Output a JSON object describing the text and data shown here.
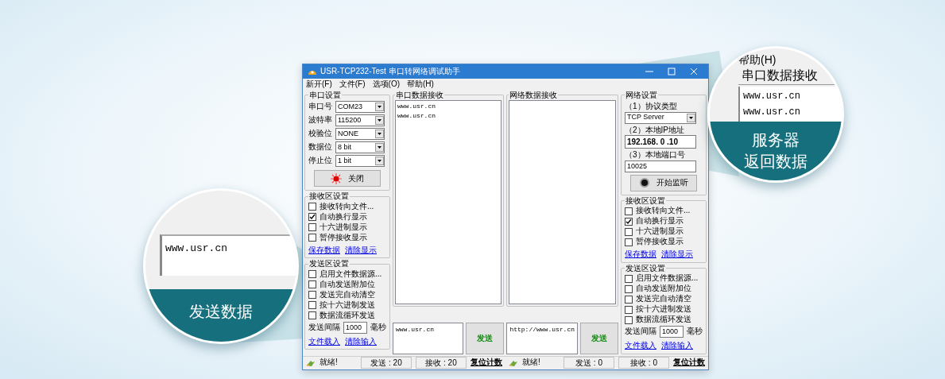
{
  "window": {
    "title": "USR-TCP232-Test 串口转网络调试助手",
    "menu": [
      "新开(F)",
      "文件(F)",
      "选项(O)",
      "帮助(H)"
    ]
  },
  "serial_settings": {
    "title": "串口设置",
    "fields": [
      {
        "label": "串口号",
        "value": "COM23"
      },
      {
        "label": "波特率",
        "value": "115200"
      },
      {
        "label": "校验位",
        "value": "NONE"
      },
      {
        "label": "数据位",
        "value": "8 bit"
      },
      {
        "label": "停止位",
        "value": "1 bit"
      }
    ],
    "button": {
      "label": "关闭",
      "active": true
    }
  },
  "serial_receive_settings": {
    "title": "接收区设置",
    "options": [
      {
        "label": "接收转向文件...",
        "checked": false
      },
      {
        "label": "自动换行显示",
        "checked": true
      },
      {
        "label": "十六进制显示",
        "checked": false
      },
      {
        "label": "暂停接收显示",
        "checked": false
      }
    ],
    "links": [
      "保存数据",
      "清除显示"
    ]
  },
  "serial_send_settings": {
    "title": "发送区设置",
    "options": [
      {
        "label": "启用文件数据源...",
        "checked": false
      },
      {
        "label": "自动发送附加位",
        "checked": false
      },
      {
        "label": "发送完自动清空",
        "checked": false
      },
      {
        "label": "按十六进制发送",
        "checked": false
      },
      {
        "label": "数据流循环发送",
        "checked": false
      }
    ],
    "interval": {
      "label": "发送间隔",
      "value": "1000",
      "unit": "毫秒"
    },
    "links": [
      "文件载入",
      "清除输入"
    ]
  },
  "serial_receive": {
    "title": "串口数据接收",
    "lines": [
      "www.usr.cn",
      "www.usr.cn"
    ]
  },
  "serial_send": {
    "value": "www.usr.cn",
    "button": "发送"
  },
  "network_receive": {
    "title": "网络数据接收"
  },
  "network_send": {
    "value": "http://www.usr.cn",
    "button": "发送"
  },
  "network_settings": {
    "title": "网络设置",
    "fields": [
      {
        "kind": "select",
        "label": "（1）协议类型",
        "value": "TCP Server"
      },
      {
        "kind": "ip",
        "label": "（2）本地IP地址",
        "value": "192.168. 0 .10"
      },
      {
        "kind": "input",
        "label": "（3）本地端口号",
        "value": "10025"
      }
    ],
    "button": {
      "label": "开始监听",
      "active": false
    }
  },
  "network_receive_settings": {
    "title": "接收区设置",
    "options": [
      {
        "label": "接收转向文件...",
        "checked": false
      },
      {
        "label": "自动换行显示",
        "checked": true
      },
      {
        "label": "十六进制显示",
        "checked": false
      },
      {
        "label": "暂停接收显示",
        "checked": false
      }
    ],
    "links": [
      "保存数据",
      "清除显示"
    ]
  },
  "network_send_settings": {
    "title": "发送区设置",
    "options": [
      {
        "label": "启用文件数据源...",
        "checked": false
      },
      {
        "label": "自动发送附加位",
        "checked": false
      },
      {
        "label": "发送完自动清空",
        "checked": false
      },
      {
        "label": "按十六进制发送",
        "checked": false
      },
      {
        "label": "数据流循环发送",
        "checked": false
      }
    ],
    "interval": {
      "label": "发送间隔",
      "value": "1000",
      "unit": "毫秒"
    },
    "links": [
      "文件载入",
      "清除输入"
    ]
  },
  "status_bars": [
    {
      "status": "就绪!",
      "sent": "发送 : 20",
      "received": "接收 : 20",
      "reset": "复位计数"
    },
    {
      "status": "就绪!",
      "sent": "发送 : 0",
      "received": "接收 : 0",
      "reset": "复位计数"
    }
  ],
  "callouts": [
    {
      "kind": "send",
      "value": "www.usr.cn",
      "caption": [
        "发送数据"
      ]
    },
    {
      "kind": "receive",
      "menu_item": "帮助(H)",
      "title": "串口数据接收",
      "lines": [
        "www.usr.cn",
        "www.usr.cn"
      ],
      "caption": [
        "服务器",
        "返回数据"
      ]
    }
  ]
}
